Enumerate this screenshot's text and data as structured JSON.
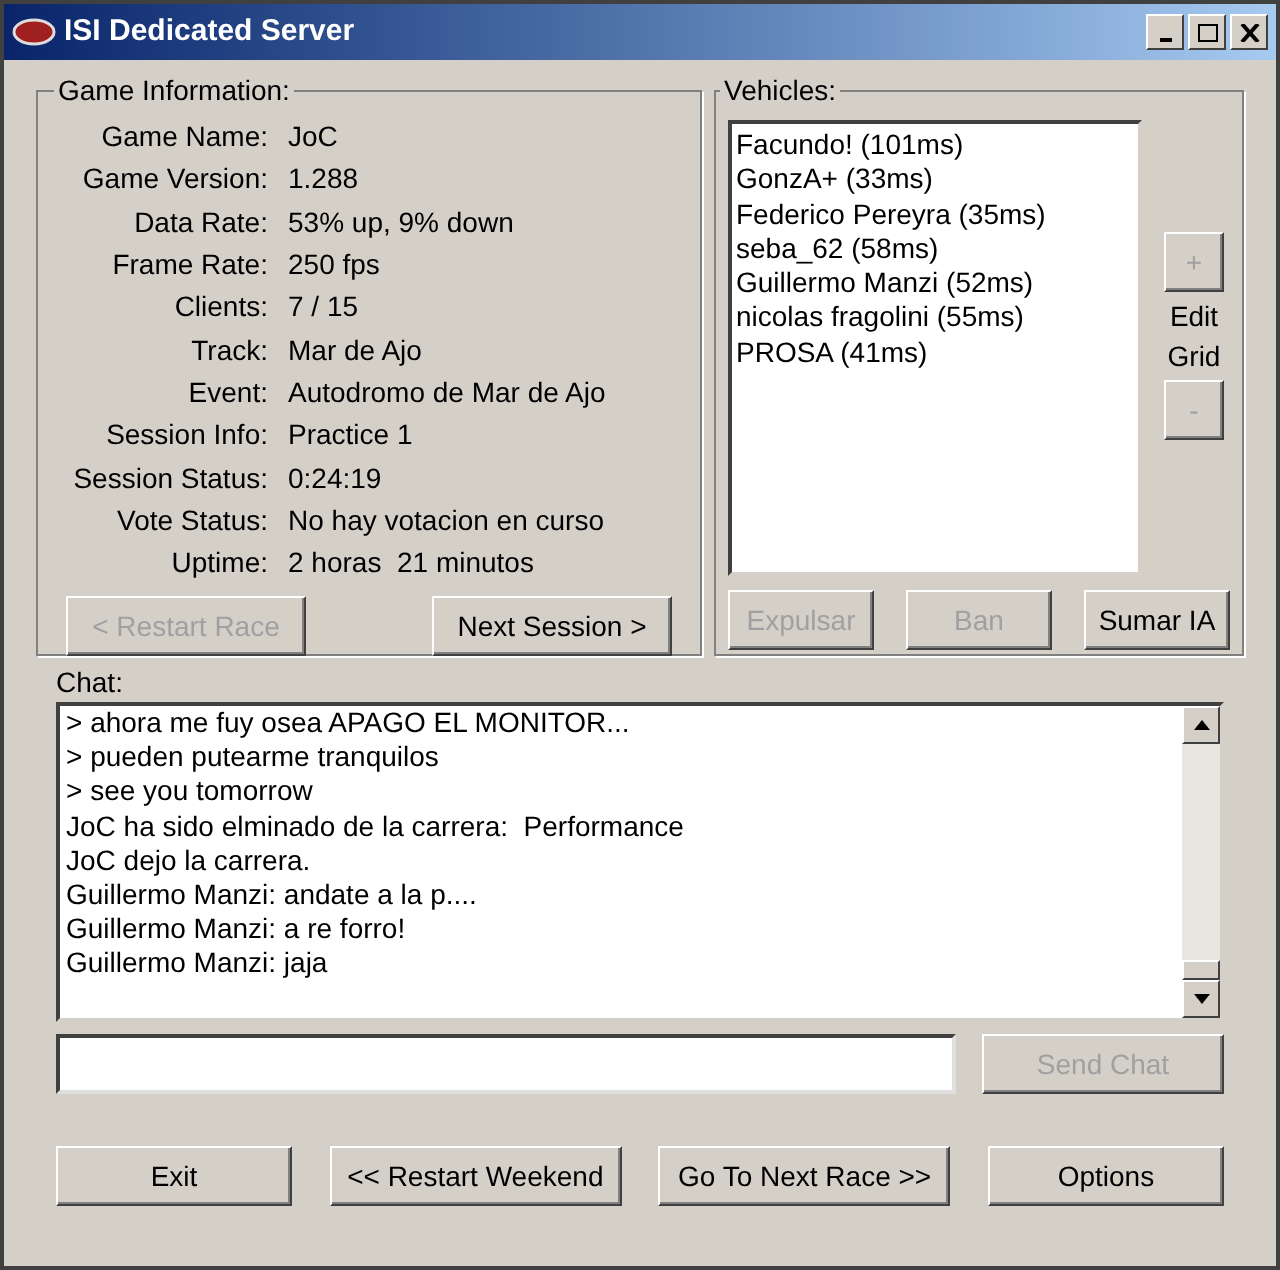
{
  "window": {
    "title": "ISI Dedicated Server"
  },
  "game_information": {
    "title": "Game Information:",
    "fields": [
      {
        "label": "Game Name:",
        "value": "JoC"
      },
      {
        "label": "Game Version:",
        "value": "1.288"
      },
      {
        "label": "Data Rate:",
        "value": "53% up, 9% down"
      },
      {
        "label": "Frame Rate:",
        "value": "250 fps"
      },
      {
        "label": "Clients:",
        "value": "7 / 15"
      },
      {
        "label": "Track:",
        "value": "Mar de Ajo"
      },
      {
        "label": "Event:",
        "value": "Autodromo de Mar de Ajo"
      },
      {
        "label": "Session Info:",
        "value": "Practice 1"
      },
      {
        "label": "Session Status:",
        "value": "0:24:19"
      },
      {
        "label": "Vote Status:",
        "value": "No hay votacion en curso"
      },
      {
        "label": "Uptime:",
        "value": "2 horas  21 minutos"
      }
    ],
    "buttons": [
      {
        "label": "< Restart Race",
        "disabled": true
      },
      {
        "label": "Next Session >",
        "disabled": false
      }
    ]
  },
  "vehicles": {
    "title": "Vehicles:",
    "items": [
      "Facundo! (101ms)",
      "GonzA+ (33ms)",
      "Federico Pereyra (35ms)",
      "seba_62 (58ms)",
      "Guillermo Manzi (52ms)",
      "nicolas fragolini (55ms)",
      "PROSA (41ms)"
    ],
    "grid_plus": {
      "label": "+",
      "disabled": true
    },
    "grid_label": "Edit Grid",
    "grid_minus": {
      "label": "-",
      "disabled": true
    },
    "buttons": [
      {
        "label": "Expulsar",
        "disabled": true
      },
      {
        "label": "Ban",
        "disabled": true
      },
      {
        "label": "Sumar IA",
        "disabled": false
      }
    ]
  },
  "chat": {
    "title": "Chat:",
    "messages": [
      "> ahora me fuy osea APAGO EL MONITOR...",
      "> pueden putearme tranquilos",
      "> see you tomorrow",
      "JoC ha sido elminado de la carrera:  Performance",
      "JoC dejo la carrera.",
      "Guillermo Manzi: andate a la p....",
      "Guillermo Manzi: a re forro!",
      "Guillermo Manzi: jaja"
    ],
    "send_button": {
      "label": "Send Chat",
      "disabled": true
    }
  },
  "bottom_buttons": [
    {
      "label": "Exit",
      "disabled": false
    },
    {
      "label": "<< Restart Weekend",
      "disabled": false
    },
    {
      "label": "Go To Next Race >>",
      "disabled": false
    },
    {
      "label": "Options",
      "disabled": false
    }
  ]
}
